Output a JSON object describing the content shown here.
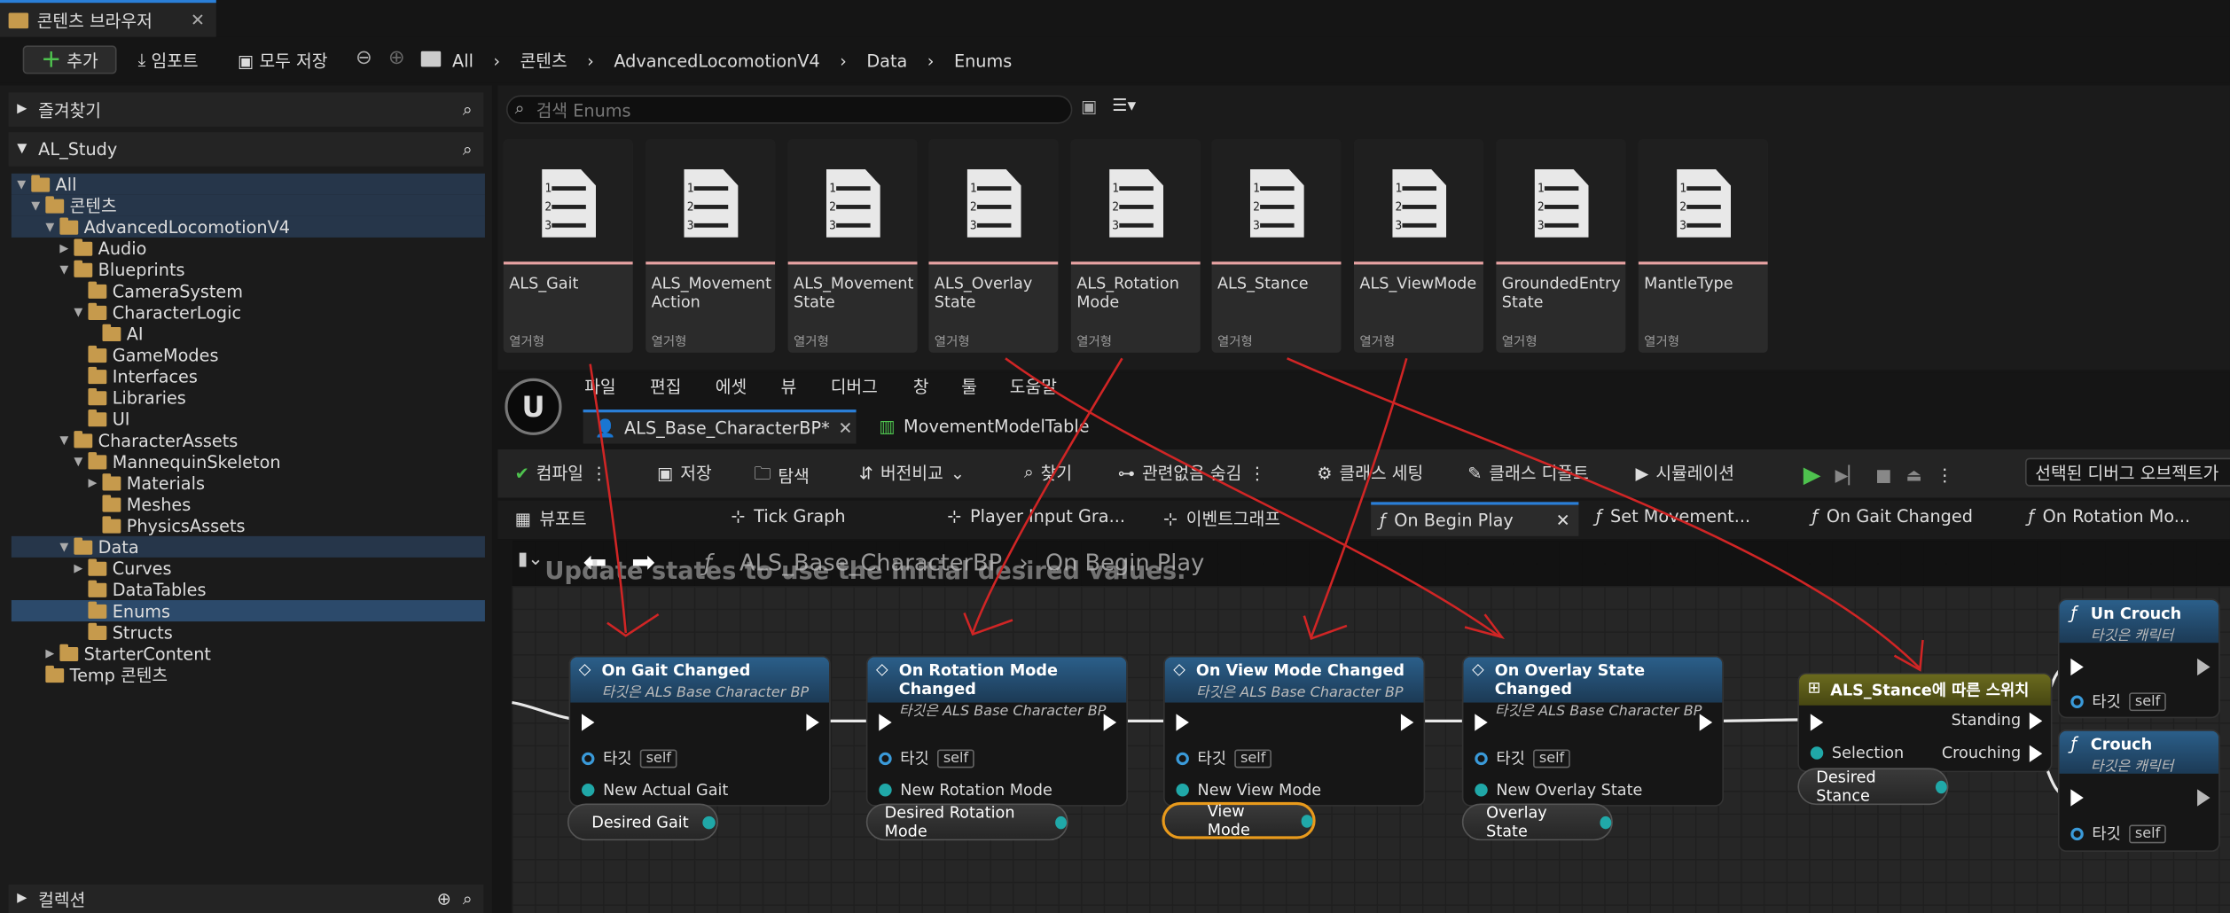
{
  "window": {
    "tab_title": "콘텐츠 브라우저"
  },
  "toolbar": {
    "add_label": "추가",
    "import_label": "임포트",
    "save_all_label": "모두 저장"
  },
  "breadcrumb": [
    "All",
    "콘텐츠",
    "AdvancedLocomotionV4",
    "Data",
    "Enums"
  ],
  "left": {
    "favorites_label": "즐겨찾기",
    "project_label": "AL_Study",
    "collections_label": "컬렉션",
    "tree": [
      "All",
      "콘텐츠",
      "AdvancedLocomotionV4",
      "Audio",
      "Blueprints",
      "CameraSystem",
      "CharacterLogic",
      "AI",
      "GameModes",
      "Interfaces",
      "Libraries",
      "UI",
      "CharacterAssets",
      "MannequinSkeleton",
      "Materials",
      "Meshes",
      "PhysicsAssets",
      "Data",
      "Curves",
      "DataTables",
      "Enums",
      "Structs",
      "StarterContent",
      "Temp 콘텐츠"
    ]
  },
  "search": {
    "placeholder": "검색 Enums"
  },
  "assets": [
    {
      "name": "ALS_Gait",
      "type": "열거형"
    },
    {
      "name": "ALS_Movement Action",
      "type": "열거형"
    },
    {
      "name": "ALS_Movement State",
      "type": "열거형"
    },
    {
      "name": "ALS_Overlay State",
      "type": "열거형"
    },
    {
      "name": "ALS_Rotation Mode",
      "type": "열거형"
    },
    {
      "name": "ALS_Stance",
      "type": "열거형"
    },
    {
      "name": "ALS_ViewMode",
      "type": "열거형"
    },
    {
      "name": "GroundedEntry State",
      "type": "열거형"
    },
    {
      "name": "MantleType",
      "type": "열거형"
    }
  ],
  "bp_menu": [
    "파일",
    "편집",
    "에셋",
    "뷰",
    "디버그",
    "창",
    "툴",
    "도움말"
  ],
  "doc_tabs": {
    "active": "ALS_Base_CharacterBP*",
    "other": "MovementModelTable"
  },
  "bp_toolbar": {
    "compile": "컴파일",
    "save": "저장",
    "browse": "탐색",
    "diff": "버전비교",
    "find": "찾기",
    "hide_unrelated": "관련없음 숨김",
    "class_settings": "클래스 세팅",
    "class_defaults": "클래스 디폴트",
    "simulation": "시뮬레이션",
    "debug_object": "선택된 디버그 오브젝트가"
  },
  "graph_tabs": [
    "뷰포트",
    "Tick Graph",
    "Player Input Gra...",
    "이벤트그래프",
    "On Begin Play",
    "Set Movement...",
    "On Gait Changed",
    "On Rotation Mo..."
  ],
  "graph": {
    "comment": "Update states to use the initial desired values.",
    "path_bp": "ALS_Base_CharacterBP",
    "path_fn": "On Begin Play",
    "target_label": "타깃",
    "self_label": "self",
    "nodes": [
      {
        "title": "On Gait Changed",
        "subtitle": "타깃은 ALS Base Character BP",
        "param": "New Actual Gait",
        "var": "Desired Gait"
      },
      {
        "title": "On Rotation Mode Changed",
        "subtitle": "타깃은 ALS Base Character BP",
        "param": "New Rotation Mode",
        "var": "Desired Rotation Mode"
      },
      {
        "title": "On View Mode Changed",
        "subtitle": "타깃은 ALS Base Character BP",
        "param": "New View Mode",
        "var": "View Mode"
      },
      {
        "title": "On Overlay State Changed",
        "subtitle": "타깃은 ALS Base Character BP",
        "param": "New Overlay State",
        "var": "Overlay State"
      }
    ],
    "switch_node": {
      "title": "ALS_Stance에 따른 스위치",
      "standing": "Standing",
      "crouching": "Crouching",
      "selection": "Selection",
      "var": "Desired Stance"
    },
    "uncrouch": {
      "title": "Un Crouch",
      "subtitle": "타깃은 캐릭터"
    },
    "crouch": {
      "title": "Crouch",
      "subtitle": "타깃은 캐릭터"
    }
  }
}
